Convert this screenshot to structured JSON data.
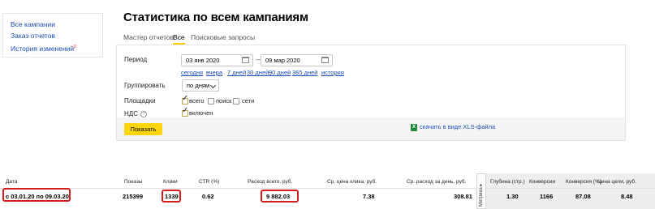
{
  "sidebar": {
    "items": [
      {
        "label": "Все кампании"
      },
      {
        "label": "Заказ отчетов"
      },
      {
        "label": "История изменений",
        "badge": "β"
      }
    ]
  },
  "page": {
    "title": "Статистика по всем кампаниям"
  },
  "tabs": [
    {
      "label": "Мастер отчетов",
      "active": false
    },
    {
      "label": "Все",
      "active": true
    },
    {
      "label": "Поисковые запросы",
      "active": false
    }
  ],
  "period": {
    "label": "Период",
    "from": "03 янв 2020",
    "to": "09 мар 2020",
    "separator": "—",
    "presets": [
      "сегодня",
      "вчера",
      "7 дней",
      "30 дней",
      "90 дней",
      "365 дней",
      "история"
    ]
  },
  "group": {
    "label": "Группировать",
    "value": "по дням"
  },
  "platforms": {
    "label": "Площадки",
    "options": [
      {
        "label": "всего",
        "checked": true
      },
      {
        "label": "поиск",
        "checked": false
      },
      {
        "label": "сети",
        "checked": false
      }
    ]
  },
  "vat": {
    "label": "НДС",
    "help": "?",
    "option": {
      "label": "включен",
      "checked": true
    }
  },
  "actions": {
    "show_label": "Показать",
    "xls_label": "скачать в виде XLS-файла",
    "xls_icon": "X"
  },
  "table": {
    "headers": {
      "date": "Дата",
      "shows": "Показы",
      "clicks": "Клики",
      "ctr": "CTR (%)",
      "cost": "Расход всего, руб.",
      "avg_click": "Ср. цена клика, руб.",
      "avg_day": "Ср. расход за день, руб.",
      "metrika": "Метрика ▸",
      "depth": "Глубина (стр.)",
      "conversions": "Конверсии",
      "conv_rate": "Конверсия (%)",
      "goal_cost": "Цена цели, руб."
    },
    "row": {
      "date": "с 03.01.20 по 09.03.20",
      "shows": "215399",
      "clicks": "1339",
      "ctr": "0.62",
      "cost": "9 882.03",
      "avg_click": "7.38",
      "avg_day": "308.81",
      "depth": "1.30",
      "conversions": "1166",
      "conv_rate": "87.08",
      "goal_cost": "8.48"
    }
  },
  "colors": {
    "accent": "#ffd60d",
    "link": "#1a4db3",
    "highlight": "#d61d1d"
  }
}
